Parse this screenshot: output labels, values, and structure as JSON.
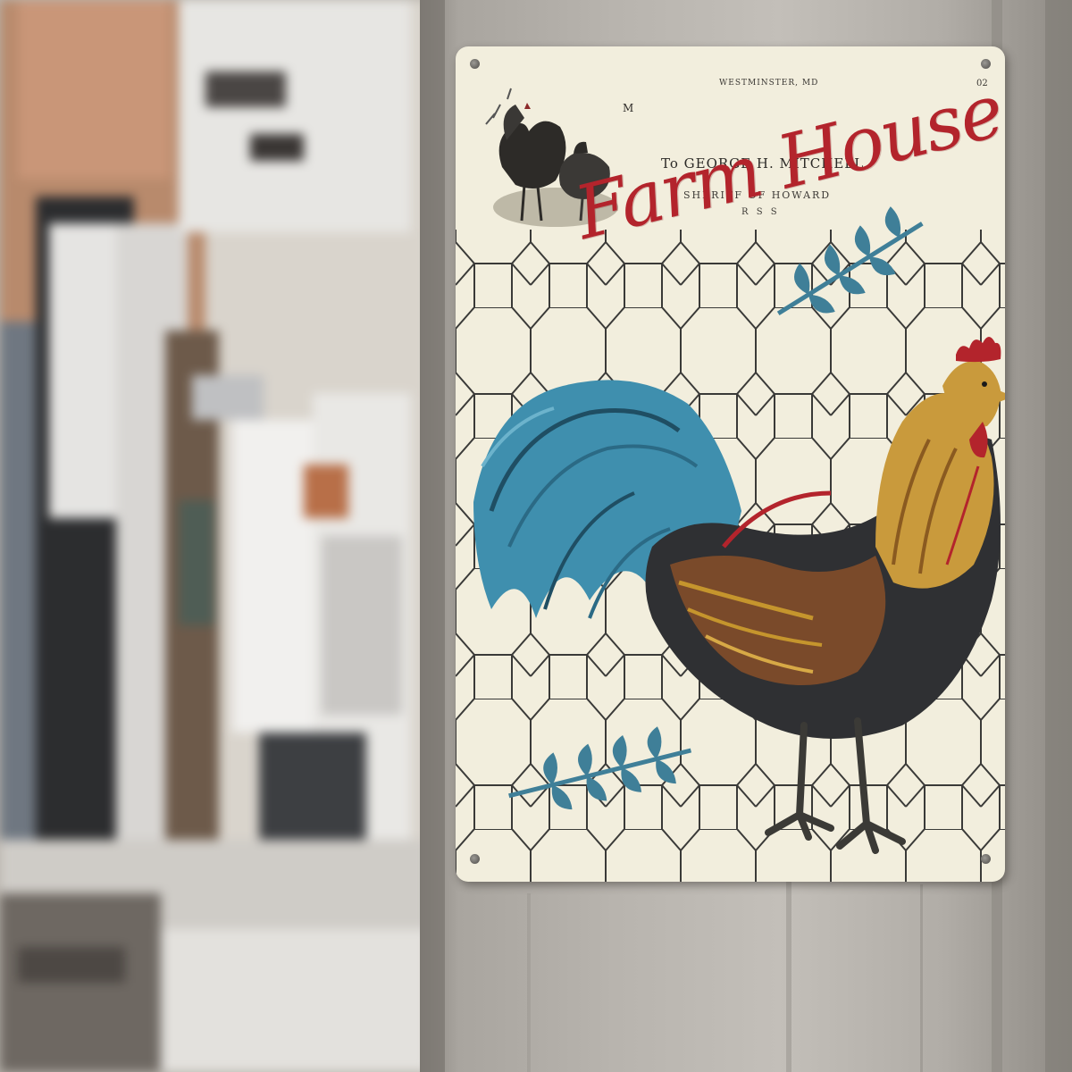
{
  "sign": {
    "header_text": "WESTMINSTER, MD",
    "letter_mark": "M",
    "corner_mark": "02",
    "addressee": "To GEORGE H. MITCHELL",
    "office": "SHERIFF OF HOWARD",
    "office_small": "R S S",
    "title": "Farm House"
  },
  "colors": {
    "title_red": "#b3242c",
    "feather_blue": "#3f8fae",
    "sign_cream": "#f2eedd",
    "wire": "#2a2a2a"
  },
  "icons": [
    "rooster-illustration",
    "small-hens-illustration",
    "leaf-sprig-icon"
  ]
}
